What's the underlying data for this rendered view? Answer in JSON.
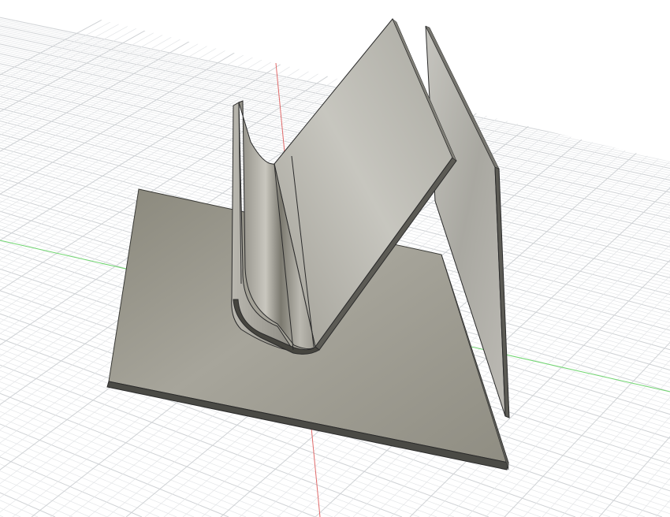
{
  "viewport": {
    "background": "#ffffff",
    "grid_minor_color": "#e4e6e8",
    "grid_major_color": "#cfd2d5",
    "x_axis_color": "#e06a6a",
    "y_axis_color": "#6fd56f"
  },
  "model": {
    "material_color": "#9c9a90",
    "edge_color": "#2b2b2b",
    "bodies": [
      {
        "name": "base-plate"
      },
      {
        "name": "bent-sheet-bracket"
      },
      {
        "name": "standing-plate"
      }
    ]
  }
}
